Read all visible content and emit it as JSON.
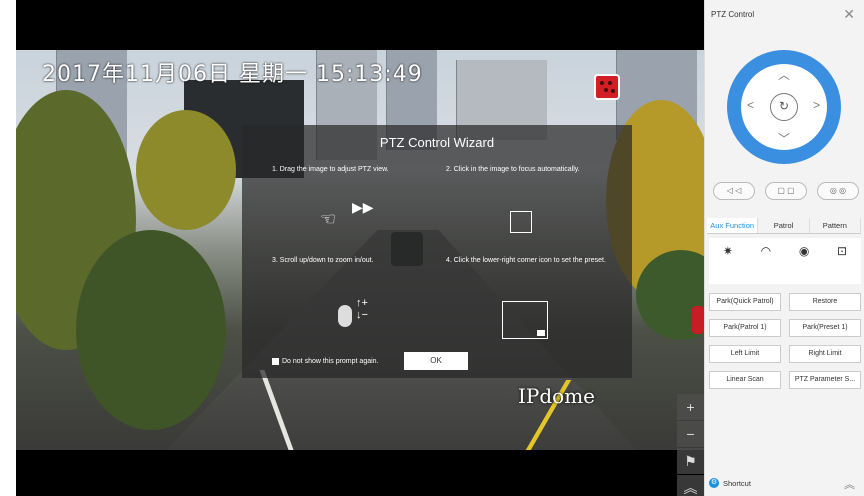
{
  "video": {
    "osd_time": "2017年11月06日 星期一 15:13:49",
    "watermark": "IPdome"
  },
  "wizard": {
    "title": "PTZ Control Wizard",
    "steps": [
      "1. Drag the image to adjust PTZ view.",
      "2. Click in the image to focus automatically.",
      "3. Scroll up/down to zoom in/out.",
      "4. Click the lower-right corner icon to set the preset."
    ],
    "dont_show_label": "Do not show this prompt again.",
    "ok_label": "OK"
  },
  "tool_strip": {
    "icons": [
      "plus-icon",
      "minus-icon",
      "flag-icon",
      "chevron-up-icon"
    ]
  },
  "panel": {
    "title": "PTZ Control",
    "tabs": [
      "Aux Function",
      "Patrol",
      "Pattern"
    ],
    "active_tab": "Aux Function",
    "buttons": [
      "Park(Quick Patrol)",
      "Restore",
      "Park(Patrol 1)",
      "Park(Preset 1)",
      "Left Limit",
      "Right Limit",
      "Linear Scan",
      "PTZ Parameter S..."
    ],
    "shortcut_label": "Shortcut",
    "accent_color": "#3a8fe0"
  }
}
